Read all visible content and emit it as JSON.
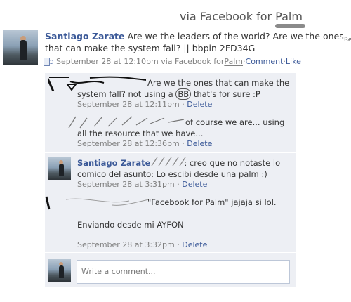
{
  "header": {
    "via_prefix": "via Facebook for ",
    "via_app": "Palm"
  },
  "right_edge_text": "Re",
  "post": {
    "author": "Santiago Zarate",
    "text": " Are we the leaders of the world? Are we the ones that can make the system fall? || bbpin 2FD34G",
    "time": "September 28 at 12:10pm via Facebook for ",
    "source": "Palm",
    "sep": " · ",
    "comment_label": "Comment",
    "like_label": "Like"
  },
  "comments": [
    {
      "text_a": "Are we the ones that can make the system fall? not using a ",
      "circled": "BB",
      "text_b": " that's for sure :P",
      "time": "September 28 at 12:11pm",
      "delete_label": "Delete"
    },
    {
      "text": "of course we are... using all the resource that we have...",
      "time": "September 28 at 12:36pm",
      "delete_label": "Delete"
    },
    {
      "author": "Santiago Zarate",
      "text": ": creo que no notaste lo comico del asunto: Lo escibi desde una palm :)",
      "time": "September 28 at 3:31pm",
      "delete_label": "Delete"
    },
    {
      "text_a": "\"Facebook for Palm\" jajaja si lol.",
      "text_b": "Enviando desde mi AYFON",
      "time": "September 28 at 3:32pm",
      "delete_label": "Delete"
    }
  ],
  "write_comment": {
    "placeholder": "Write a comment..."
  },
  "colors": {
    "link": "#3b5998",
    "comment_bg": "#edeff4",
    "meta": "#808080"
  },
  "icons": {
    "source": "mobile-source-icon"
  }
}
